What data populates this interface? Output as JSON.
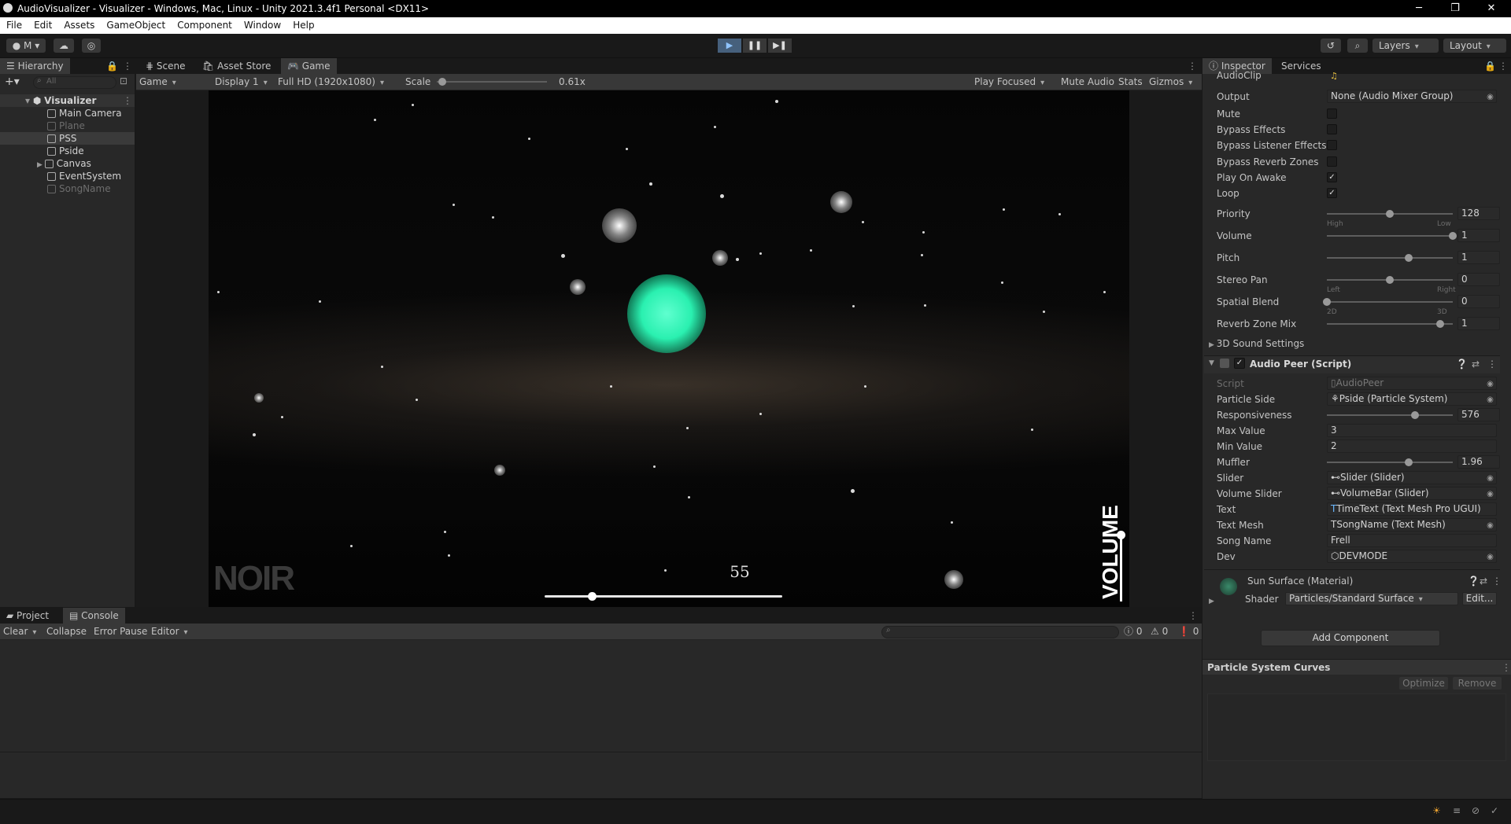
{
  "window": {
    "title": "AudioVisualizer - Visualizer - Windows, Mac, Linux - Unity 2021.3.4f1 Personal <DX11>",
    "minimize": "─",
    "maximize": "❐",
    "close": "✕"
  },
  "menu": [
    "File",
    "Edit",
    "Assets",
    "GameObject",
    "Component",
    "Window",
    "Help"
  ],
  "toolbar": {
    "account": "M",
    "layers": "Layers",
    "layout": "Layout"
  },
  "hierarchy": {
    "tab": "Hierarchy",
    "search_placeholder": "All",
    "scene": "Visualizer",
    "items": [
      {
        "label": "Main Camera",
        "dim": false
      },
      {
        "label": "Plane",
        "dim": true
      },
      {
        "label": "PSS",
        "dim": false
      },
      {
        "label": "Pside",
        "dim": false
      },
      {
        "label": "Canvas",
        "dim": false
      },
      {
        "label": "EventSystem",
        "dim": false
      },
      {
        "label": "SongName",
        "dim": true
      }
    ]
  },
  "tabs": {
    "scene": "Scene",
    "asset_store": "Asset Store",
    "game": "Game"
  },
  "game_toolbar": {
    "view": "Game",
    "display": "Display 1",
    "resolution": "Full HD (1920x1080)",
    "scale_label": "Scale",
    "scale_value": "0.61x",
    "scale_fraction": 0.05,
    "play_focused": "Play Focused",
    "mute_audio": "Mute Audio",
    "stats": "Stats",
    "gizmos": "Gizmos"
  },
  "game_view": {
    "song_time": "55",
    "progress": 0.2,
    "volume_label": "VOLUME",
    "volume": 0.95,
    "watermark": "NOIR"
  },
  "console": {
    "tabs": {
      "project": "Project",
      "console": "Console"
    },
    "clear": "Clear",
    "collapse": "Collapse",
    "error_pause": "Error Pause",
    "editor": "Editor",
    "counts": {
      "info": "0",
      "warn": "0",
      "error": "0"
    }
  },
  "inspector": {
    "tabs": {
      "inspector": "Inspector",
      "services": "Services"
    },
    "audio_clip_label": "AudioClip",
    "output": {
      "label": "Output",
      "value": "None (Audio Mixer Group)"
    },
    "checks": [
      {
        "label": "Mute",
        "checked": false
      },
      {
        "label": "Bypass Effects",
        "checked": false
      },
      {
        "label": "Bypass Listener Effects",
        "checked": false
      },
      {
        "label": "Bypass Reverb Zones",
        "checked": false
      },
      {
        "label": "Play On Awake",
        "checked": true
      },
      {
        "label": "Loop",
        "checked": true
      }
    ],
    "sliders": [
      {
        "label": "Priority",
        "value": "128",
        "fraction": 0.5,
        "left": "High",
        "right": "Low"
      },
      {
        "label": "Volume",
        "value": "1",
        "fraction": 1.0,
        "left": "",
        "right": ""
      },
      {
        "label": "Pitch",
        "value": "1",
        "fraction": 0.65,
        "left": "",
        "right": ""
      },
      {
        "label": "Stereo Pan",
        "value": "0",
        "fraction": 0.5,
        "left": "Left",
        "right": "Right"
      },
      {
        "label": "Spatial Blend",
        "value": "0",
        "fraction": 0.0,
        "left": "2D",
        "right": "3D"
      },
      {
        "label": "Reverb Zone Mix",
        "value": "1",
        "fraction": 0.9,
        "left": "",
        "right": ""
      }
    ],
    "sound_settings": "3D Sound Settings",
    "script_component": {
      "title": "Audio Peer (Script)",
      "script": {
        "label": "Script",
        "value": "AudioPeer"
      },
      "particle_side": {
        "label": "Particle Side",
        "value": "Pside (Particle System)"
      },
      "responsiveness": {
        "label": "Responsiveness",
        "value": "576",
        "fraction": 0.7
      },
      "max_value": {
        "label": "Max Value",
        "value": "3"
      },
      "min_value": {
        "label": "Min Value",
        "value": "2"
      },
      "muffler": {
        "label": "Muffler",
        "value": "1.96",
        "fraction": 0.65
      },
      "slider": {
        "label": "Slider",
        "value": "Slider (Slider)"
      },
      "volume_slider": {
        "label": "Volume Slider",
        "value": "VolumeBar (Slider)"
      },
      "text": {
        "label": "Text",
        "value": "TimeText (Text Mesh Pro UGUI)"
      },
      "text_mesh": {
        "label": "Text Mesh",
        "value": "SongName (Text Mesh)"
      },
      "song_name": {
        "label": "Song Name",
        "value": "Frell"
      },
      "dev": {
        "label": "Dev",
        "value": "DEVMODE"
      }
    },
    "material": {
      "name": "Sun Surface (Material)",
      "shader_label": "Shader",
      "shader": "Particles/Standard Surface",
      "edit": "Edit..."
    },
    "add_component": "Add Component",
    "curves": {
      "title": "Particle System Curves",
      "optimize": "Optimize",
      "remove": "Remove"
    }
  }
}
